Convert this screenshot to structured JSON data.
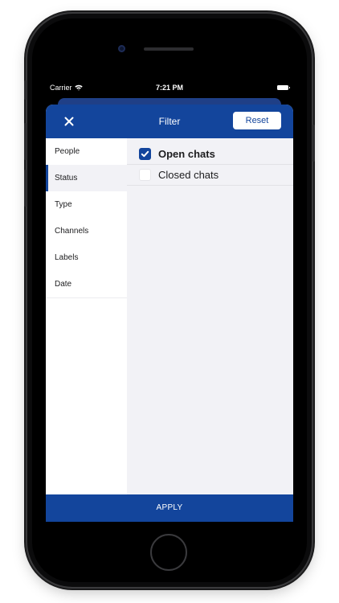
{
  "status_bar": {
    "carrier": "Carrier",
    "time": "7:21 PM"
  },
  "header": {
    "title": "Filter",
    "reset_label": "Reset",
    "close_icon": "close-icon"
  },
  "sidebar": {
    "items": [
      {
        "label": "People",
        "active": false
      },
      {
        "label": "Status",
        "active": true
      },
      {
        "label": "Type",
        "active": false
      },
      {
        "label": "Channels",
        "active": false
      },
      {
        "label": "Labels",
        "active": false
      },
      {
        "label": "Date",
        "active": false
      }
    ]
  },
  "status_options": [
    {
      "label": "Open chats",
      "checked": true
    },
    {
      "label": "Closed chats",
      "checked": false
    }
  ],
  "footer": {
    "apply_label": "APPLY"
  },
  "colors": {
    "brand": "#13459c",
    "content_background": "#f2f2f6"
  }
}
